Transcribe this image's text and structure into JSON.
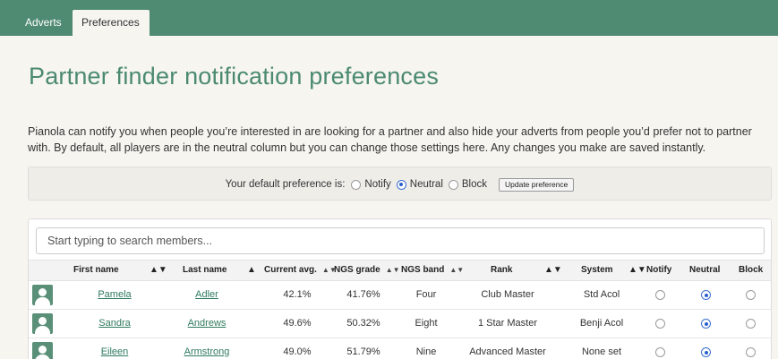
{
  "tabs": [
    {
      "label": "Adverts",
      "active": false
    },
    {
      "label": "Preferences",
      "active": true
    }
  ],
  "page_title": "Partner finder notification preferences",
  "intro": "Pianola can notify you when people you’re interested in are looking for a partner and also hide your adverts from people you’d prefer not to partner with. By default, all players are in the neutral column but you can change those settings here. Any changes you make are saved instantly.",
  "default_pref": {
    "label": "Your default preference is:",
    "options": [
      "Notify",
      "Neutral",
      "Block"
    ],
    "selected": "Neutral",
    "update_label": "Update preference"
  },
  "search": {
    "placeholder": "Start typing to search members..."
  },
  "table": {
    "columns": [
      "First name",
      "Last name",
      "Current avg.",
      "NGS grade",
      "NGS band",
      "Rank",
      "System",
      "Notify",
      "Neutral",
      "Block"
    ],
    "rows": [
      {
        "first": "Pamela",
        "last": "Adler",
        "avg": "42.1%",
        "ngs_grade": "41.76%",
        "ngs_band": "Four",
        "rank": "Club Master",
        "system": "Std Acol",
        "pref": "Neutral"
      },
      {
        "first": "Sandra",
        "last": "Andrews",
        "avg": "49.6%",
        "ngs_grade": "50.32%",
        "ngs_band": "Eight",
        "rank": "1 Star Master",
        "system": "Benji Acol",
        "pref": "Neutral"
      },
      {
        "first": "Eileen",
        "last": "Armstrong",
        "avg": "49.0%",
        "ngs_grade": "51.79%",
        "ngs_band": "Nine",
        "rank": "Advanced Master",
        "system": "None set",
        "pref": "Neutral"
      }
    ]
  },
  "colors": {
    "brand": "#4f8a72",
    "link": "#2e7a5e",
    "radio_selected": "#2a5fcc"
  }
}
